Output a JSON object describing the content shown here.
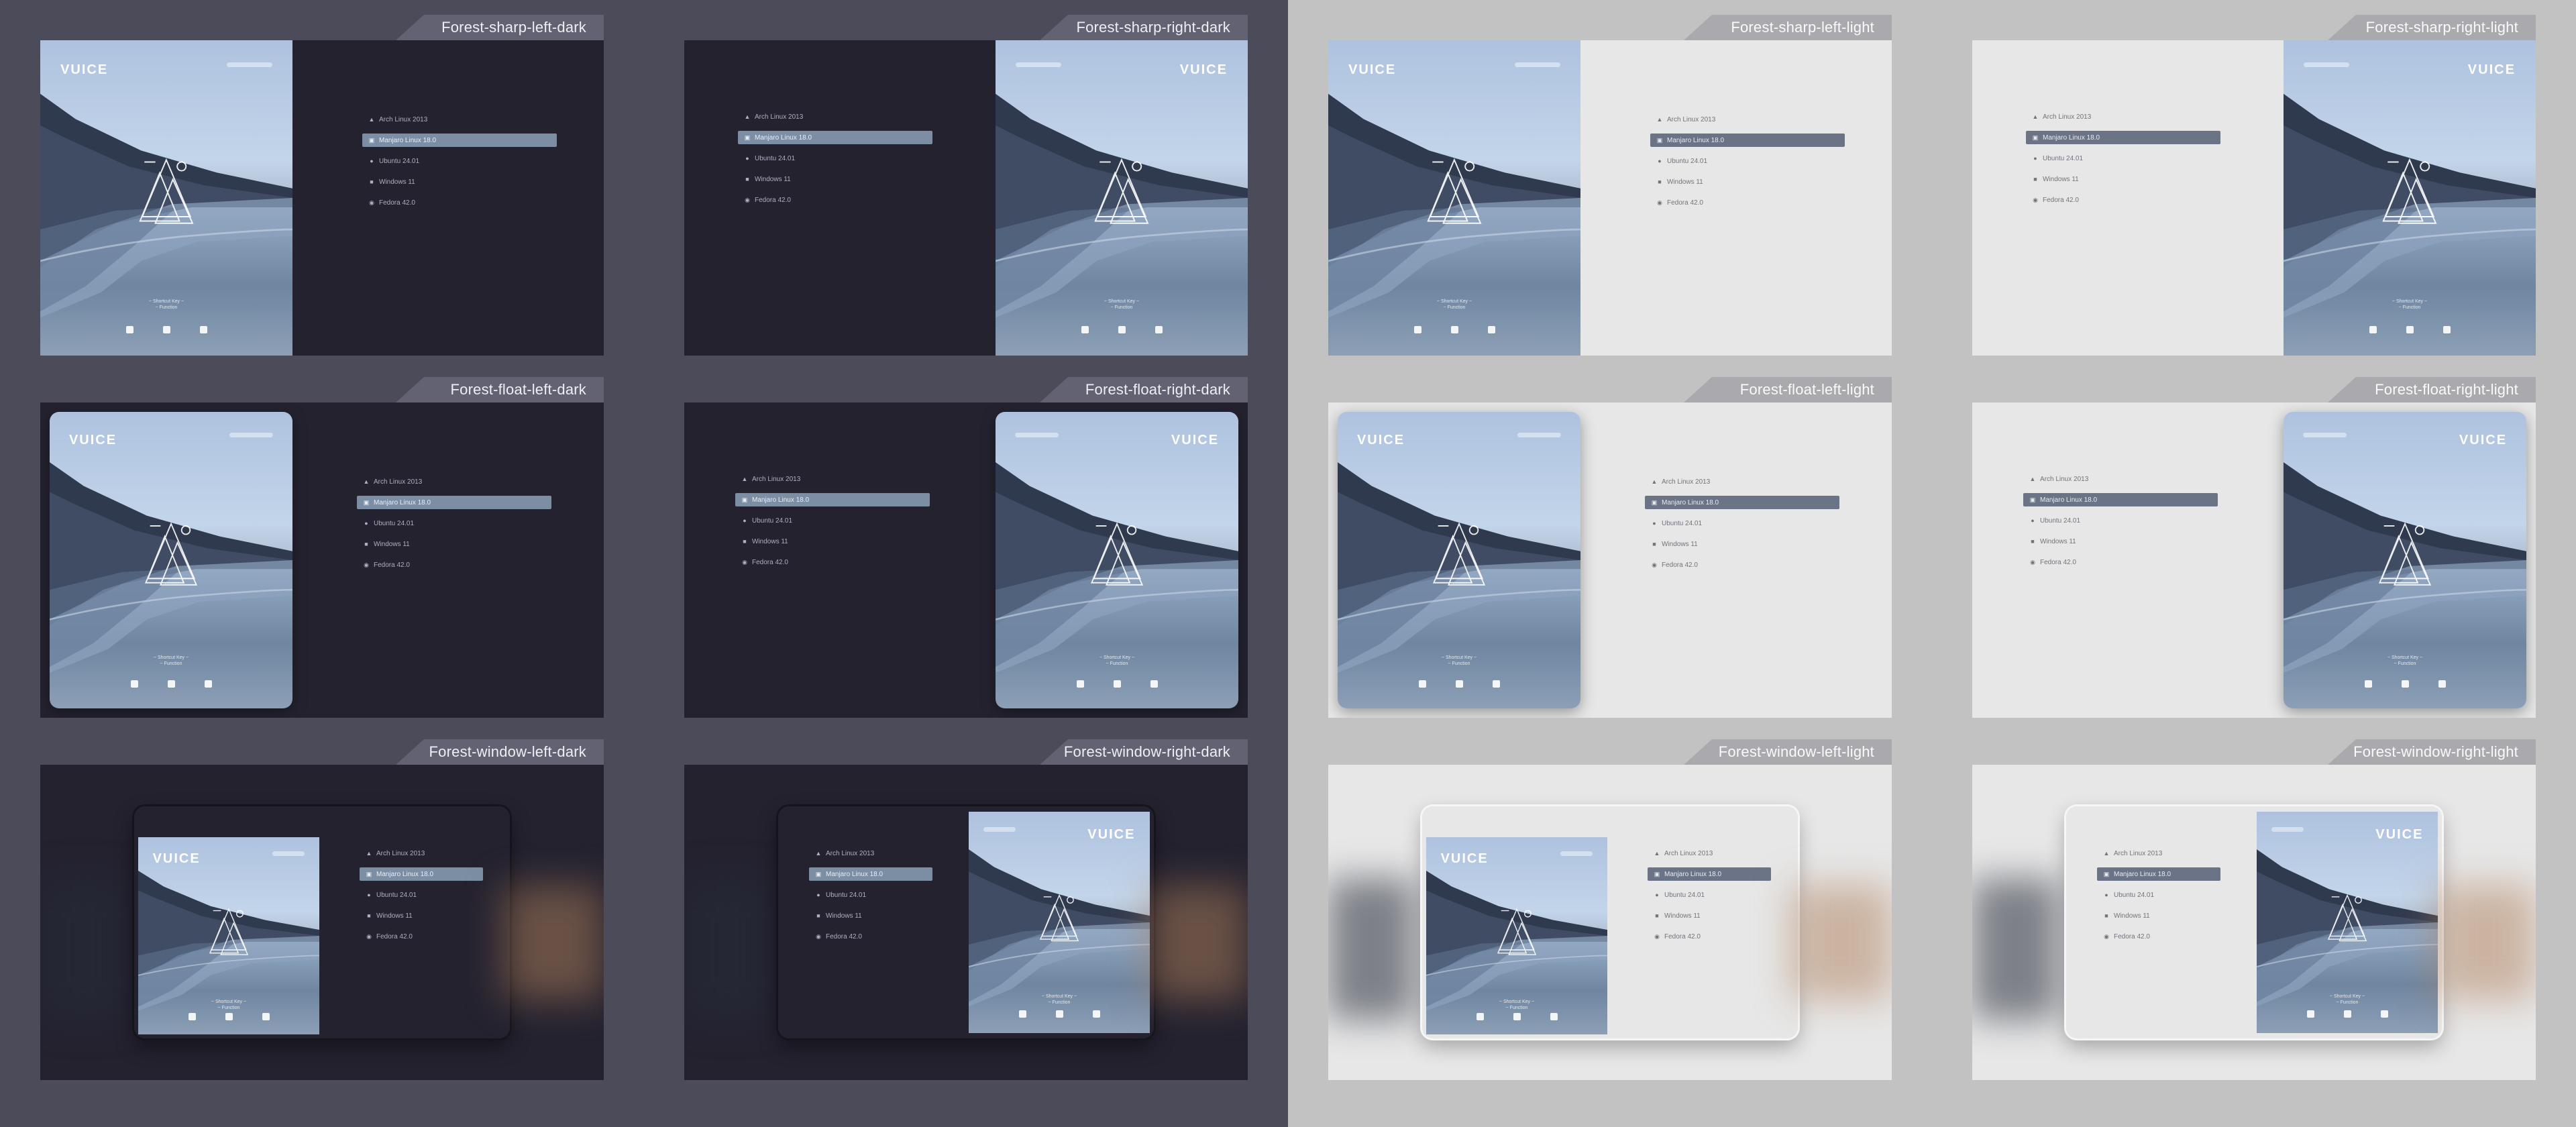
{
  "variants": [
    {
      "label": "Forest-sharp-left-dark"
    },
    {
      "label": "Forest-sharp-right-dark"
    },
    {
      "label": "Forest-sharp-left-light"
    },
    {
      "label": "Forest-sharp-right-light"
    },
    {
      "label": "Forest-float-left-dark"
    },
    {
      "label": "Forest-float-right-dark"
    },
    {
      "label": "Forest-float-left-light"
    },
    {
      "label": "Forest-float-right-light"
    },
    {
      "label": "Forest-window-left-dark"
    },
    {
      "label": "Forest-window-right-dark"
    },
    {
      "label": "Forest-window-left-light"
    },
    {
      "label": "Forest-window-right-light"
    }
  ],
  "menu": {
    "items": [
      {
        "label": "Arch Linux 2013",
        "icon": "arch-icon"
      },
      {
        "label": "Manjaro Linux 18.0",
        "icon": "manjaro-icon"
      },
      {
        "label": "Ubuntu 24.01",
        "icon": "ubuntu-icon"
      },
      {
        "label": "Windows 11",
        "icon": "windows-icon"
      },
      {
        "label": "Fedora 42.0",
        "icon": "fedora-icon"
      }
    ],
    "selected_index": 1
  },
  "wallpaper": {
    "logo": "VUICE",
    "quote_line1": "~ Shortcut Key ~",
    "quote_line2": "~ Function"
  },
  "colors": {
    "dark_background": "#4c4b59",
    "light_background": "#c2c2c2",
    "dark_selected": "#7b8ea4",
    "light_selected": "#6b7486"
  }
}
